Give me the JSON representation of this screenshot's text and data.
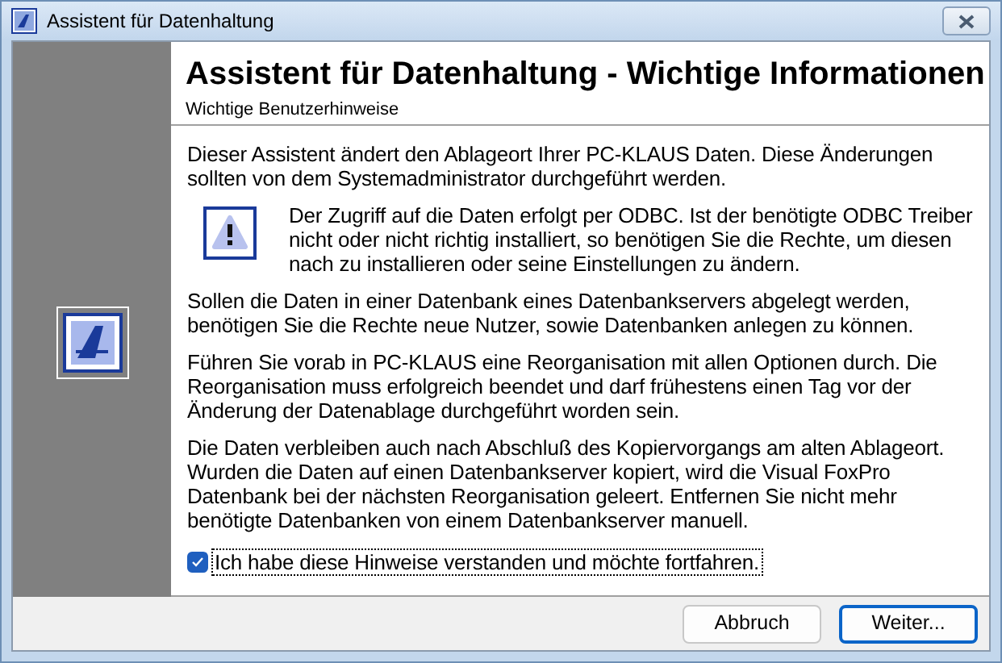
{
  "window": {
    "title": "Assistent für Datenhaltung"
  },
  "header": {
    "title": "Assistent für Datenhaltung - Wichtige Informationen",
    "subtitle": "Wichtige Benutzerhinweise"
  },
  "paragraphs": [
    {
      "kind": "text",
      "text": "Dieser Assistent ändert den Ablageort Ihrer PC-KLAUS Daten. Diese Änderungen sollten von dem Systemadministrator durchgeführt werden."
    },
    {
      "kind": "warning",
      "text": "Der Zugriff auf die Daten erfolgt per ODBC. Ist der benötigte ODBC Treiber nicht oder nicht richtig installiert, so benötigen Sie die Rechte, um diesen nach zu installieren oder seine Einstellungen zu ändern."
    },
    {
      "kind": "text",
      "text": "Sollen die Daten in einer Datenbank eines Datenbankservers abgelegt werden, benötigen Sie die Rechte neue Nutzer, sowie Datenbanken anlegen zu können."
    },
    {
      "kind": "text",
      "text": "Führen Sie vorab in PC-KLAUS eine Reorganisation mit allen Optionen durch. Die Reorganisation muss erfolgreich beendet und darf frühestens einen Tag vor der Änderung der Datenablage durchgeführt worden sein."
    },
    {
      "kind": "text",
      "text": "Die Daten verbleiben auch nach Abschluß des Kopiervorgangs am alten Ablageort. Wurden die Daten auf einen Datenbankserver kopiert, wird die Visual FoxPro Datenbank bei der nächsten Reorganisation geleert. Entfernen Sie nicht mehr benötigte Datenbanken von einem Datenbankserver manuell."
    }
  ],
  "confirm": {
    "label": "Ich habe diese Hinweise verstanden und möchte fortfahren.",
    "checked": true
  },
  "buttons": [
    {
      "label": "Abbruch",
      "default": false
    },
    {
      "label": "Weiter...",
      "default": true
    }
  ]
}
